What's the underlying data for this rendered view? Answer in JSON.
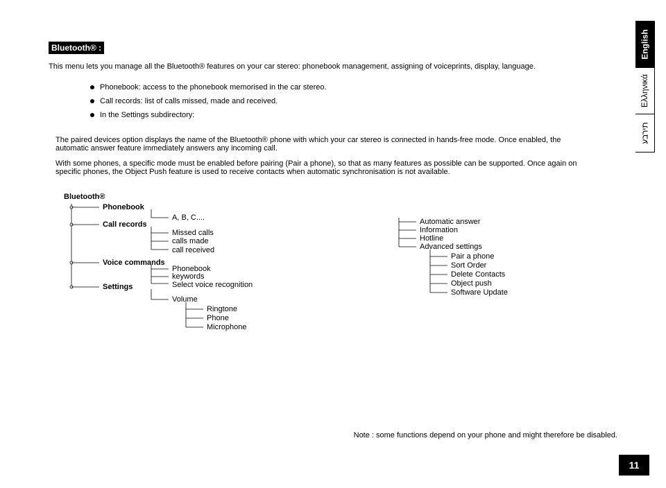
{
  "sectionTitle": "Bluetooth® :",
  "intro": "This menu lets you manage all the Bluetooth® features on your car stereo: phonebook management, assigning of voiceprints, display, language.",
  "bullets": [
    "Phonebook: access to the phonebook memorised in the car stereo.",
    "Call records: list of calls missed, made and received.",
    "In the Settings subdirectory:"
  ],
  "paragraphs": [
    "The paired devices option displays the name of the Bluetooth® phone with which your car stereo is connected in hands-free mode. Once enabled, the automatic answer feature immediately answers any incoming call.",
    "With some phones, a specific mode must be enabled before pairing (Pair a phone), so that as many features as possible can be supported. Once again on specific phones, the Object Push feature is used to receive contacts when automatic synchronisation is not available."
  ],
  "tree": {
    "root": "Bluetooth®",
    "l1": {
      "phonebook": "Phonebook",
      "callRecords": "Call records",
      "voiceCommands": "Voice commands",
      "settings": "Settings"
    },
    "l2": {
      "abc": "A, B, C....",
      "missed": "Missed calls",
      "made": "calls made",
      "received": "call received",
      "phonebookVc": "Phonebook",
      "keywords": "keywords",
      "selectVoice": "Select voice recognition",
      "volume": "Volume"
    },
    "l3": {
      "ringtone": "Ringtone",
      "phone": "Phone",
      "microphone": "Microphone"
    },
    "right1": {
      "autoAnswer": "Automatic answer",
      "information": "Information",
      "hotline": "Hotline",
      "advanced": "Advanced settings"
    },
    "right2": {
      "pair": "Pair a phone",
      "sort": "Sort Order",
      "deleteC": "Delete Contacts",
      "objectPush": "Object push",
      "software": "Software Update"
    }
  },
  "langTabs": {
    "english": "English",
    "greek": "Ελληνικά",
    "hebrew": "תירבע"
  },
  "note": "Note : some functions depend on your phone and might therefore be disabled.",
  "pageNumber": "11"
}
